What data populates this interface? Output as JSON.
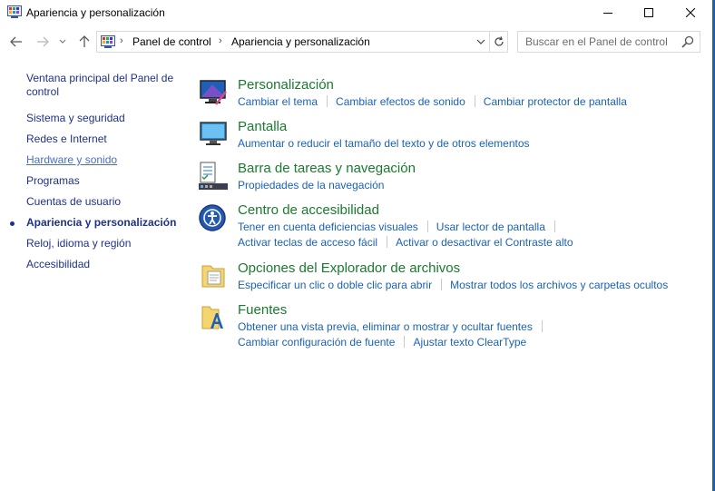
{
  "window": {
    "title": "Apariencia y personalización",
    "icon": "control-panel-icon",
    "controls": [
      "minimize-icon",
      "maximize-icon",
      "close-icon"
    ]
  },
  "nav": {
    "back_icon": "arrow-left-icon",
    "forward_icon": "arrow-right-icon",
    "recent_icon": "chevron-down-icon",
    "up_icon": "arrow-up-icon",
    "breadcrumb": [
      "Panel de control",
      "Apariencia y personalización"
    ],
    "search_placeholder": "Buscar en el Panel de control"
  },
  "sidebar": {
    "items": [
      {
        "label": "Ventana principal del Panel de control"
      },
      {
        "label": "Sistema y seguridad"
      },
      {
        "label": "Redes e Internet"
      },
      {
        "label": "Hardware y sonido"
      },
      {
        "label": "Programas"
      },
      {
        "label": "Cuentas de usuario"
      },
      {
        "label": "Apariencia y personalización"
      },
      {
        "label": "Reloj, idioma y región"
      },
      {
        "label": "Accesibilidad"
      }
    ],
    "active_index": 6
  },
  "categories": [
    {
      "title": "Personalización",
      "icon": "personalization-icon",
      "tasks": [
        [
          "Cambiar el tema",
          "Cambiar efectos de sonido",
          "Cambiar protector de pantalla"
        ]
      ]
    },
    {
      "title": "Pantalla",
      "icon": "display-icon",
      "tasks": [
        [
          "Aumentar o reducir el tamaño del texto y de otros elementos"
        ]
      ]
    },
    {
      "title": "Barra de tareas y navegación",
      "icon": "taskbar-icon",
      "tasks": [
        [
          "Propiedades de la navegación"
        ]
      ]
    },
    {
      "title": "Centro de accesibilidad",
      "icon": "ease-of-access-icon",
      "tasks": [
        [
          "Tener en cuenta deficiencias visuales",
          "Usar lector de pantalla"
        ],
        [
          "Activar teclas de acceso fácil",
          "Activar o desactivar el Contraste alto"
        ]
      ]
    },
    {
      "title": "Opciones del Explorador de archivos",
      "icon": "folder-options-icon",
      "tasks": [
        [
          "Especificar un clic o doble clic para abrir",
          "Mostrar todos los archivos y carpetas ocultos"
        ]
      ]
    },
    {
      "title": "Fuentes",
      "icon": "fonts-icon",
      "tasks": [
        [
          "Obtener una vista previa, eliminar o mostrar y ocultar fuentes"
        ],
        [
          "Cambiar configuración de fuente",
          "Ajustar texto ClearType"
        ]
      ]
    }
  ],
  "colors": {
    "link": "#1a62b8",
    "category_title": "#1a7a2e",
    "sidebar_text": "#1e3287",
    "window_border": "#1f5fa8"
  }
}
